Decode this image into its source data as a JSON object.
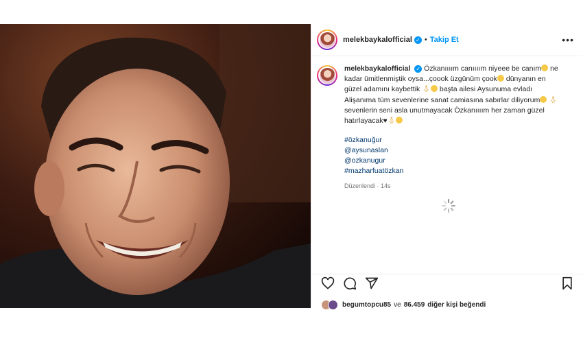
{
  "account": {
    "username": "melekbaykalofficial",
    "follow_label": "Takip Et",
    "separator": "•"
  },
  "caption": {
    "p1": "Özkanıııım canıııım niyeee be canım",
    "p2": "ne kadar ümitlenmiştik oysa...çoook üzgünüm çook",
    "p3": "dünyanın en güzel adamını kaybettik",
    "p4": "başta ailesi Aysunuma evladı Alişanıma tüm sevenlerine sanat camiasına sabırlar diliyorum",
    "p5": "sevenlerin seni asla unutmayacak Özkanıııım her zaman güzel hatırlayacak",
    "hashtags": [
      "#özkanuğur",
      "@aysunaslan",
      "@ozkanugur",
      "#mazharfuatözkan"
    ],
    "edited": "Düzenlendi · 14s"
  },
  "icons": {
    "like": "heart-outline-icon",
    "comment": "comment-icon",
    "share": "paper-plane-icon",
    "save": "bookmark-icon"
  },
  "likes": {
    "username": "begumtopcu85",
    "connector": "ve",
    "count": "86.459",
    "suffix": "diğer kişi beğendi"
  },
  "colors": {
    "accent": "#0095f6",
    "tag": "#00376b",
    "muted": "#737373"
  }
}
